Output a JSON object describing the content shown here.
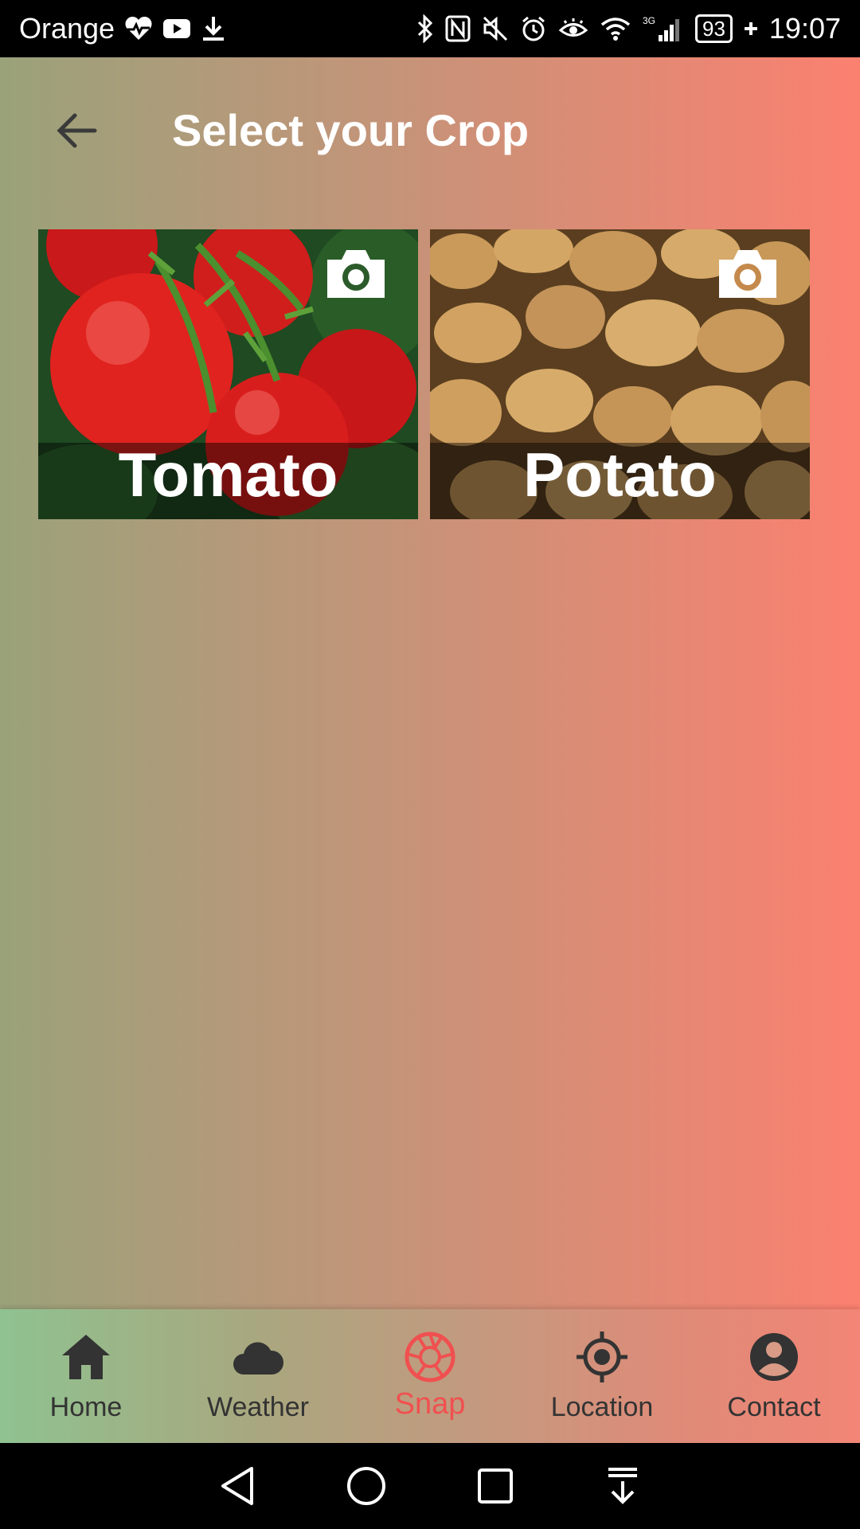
{
  "status_bar": {
    "carrier": "Orange",
    "network_type": "3G",
    "battery": "93",
    "time": "19:07"
  },
  "header": {
    "title": "Select your Crop"
  },
  "crops": [
    {
      "label": "Tomato",
      "icon": "camera-icon"
    },
    {
      "label": "Potato",
      "icon": "camera-icon"
    }
  ],
  "bottom_nav": {
    "items": [
      {
        "label": "Home",
        "icon": "home-icon"
      },
      {
        "label": "Weather",
        "icon": "cloud-icon"
      },
      {
        "label": "Snap",
        "icon": "shutter-icon",
        "active": true
      },
      {
        "label": "Location",
        "icon": "crosshair-icon"
      },
      {
        "label": "Contact",
        "icon": "account-icon"
      }
    ]
  },
  "colors": {
    "active_nav": "#f05050",
    "gradient_start": "#9aa27a",
    "gradient_end": "#fb8070"
  }
}
